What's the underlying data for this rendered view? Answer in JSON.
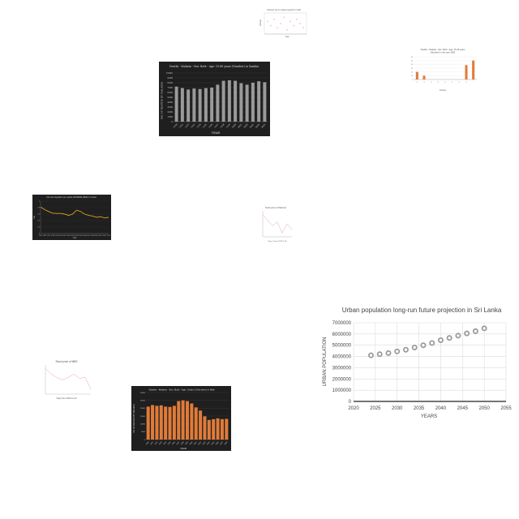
{
  "chart_data": [
    {
      "id": "scatter_top",
      "type": "scatter",
      "title": "Uranium use in nuclear reactors in USA",
      "xlabel": "Year",
      "ylabel": "Tonnes",
      "x": [
        1,
        2,
        3,
        4,
        5,
        6,
        7,
        8,
        9,
        10,
        11,
        12
      ],
      "values": [
        6,
        4,
        7,
        3,
        5,
        8,
        2,
        6,
        4,
        7,
        5,
        3
      ],
      "xlim": [
        0,
        13
      ],
      "ylim": [
        0,
        10
      ],
      "colors": {
        "marker": "#d66a8a"
      }
    },
    {
      "id": "bar_orange_small",
      "type": "bar",
      "title": "Deaths - Malaria - Sex: Both - Age: 15-49 years",
      "subtitle": "(Number) in the year 1990",
      "xlabel": "Country",
      "categories": [
        "A",
        "B",
        "C",
        "D",
        "E",
        "F",
        "G",
        "H",
        "I"
      ],
      "values": [
        20,
        10,
        0,
        0,
        0,
        0,
        0,
        38,
        50
      ],
      "ylim": [
        0,
        60
      ],
      "colors": {
        "bar": "#e07b39"
      }
    },
    {
      "id": "bar_dark_grey",
      "type": "bar",
      "title": "Deaths - Malaria - Sex: Both - Age: 15-49 years (Number) in Zambia",
      "xlabel": "YEAR",
      "ylabel": "NO OF DEATHS BY MALARIA",
      "categories": [
        "1990",
        "1991",
        "1992",
        "1993",
        "1994",
        "1995",
        "1996",
        "1997",
        "1998",
        "1999",
        "2000",
        "2001",
        "2002",
        "2003",
        "2004",
        "2005"
      ],
      "values": [
        7200,
        6900,
        6600,
        6800,
        6700,
        6900,
        7000,
        7600,
        8400,
        8500,
        8400,
        7900,
        7600,
        8000,
        8300,
        8100
      ],
      "ylim": [
        0,
        10000
      ],
      "colors": {
        "bar": "#9a9a9a",
        "background": "#1f1f1f"
      }
    },
    {
      "id": "line_dark_orange",
      "type": "line",
      "title": "Net net migration per capita (NORMALIZED) in Israel",
      "xlabel": "Year",
      "ylabel": "Net",
      "x": [
        1995,
        1996,
        1997,
        1998,
        1999,
        2000,
        2001,
        2002,
        2003,
        2004,
        2005,
        2006,
        2007,
        2008,
        2009,
        2010,
        2011,
        2012
      ],
      "values": [
        0.82,
        0.74,
        0.68,
        0.63,
        0.62,
        0.62,
        0.6,
        0.56,
        0.6,
        0.72,
        0.68,
        0.6,
        0.56,
        0.54,
        0.5,
        0.52,
        0.48,
        0.5
      ],
      "ylim": [
        0,
        1
      ],
      "colors": {
        "line": "#d9a21b",
        "background": "#1f1f1f"
      }
    },
    {
      "id": "line_pink_mid",
      "type": "line",
      "title": "Stock price of Walmart",
      "xlabel": "Days / Years 2019 to 20",
      "x": [
        1,
        2,
        3,
        4,
        5,
        6,
        7
      ],
      "values": [
        60,
        45,
        30,
        40,
        10,
        35,
        20
      ],
      "ylim": [
        0,
        70
      ],
      "colors": {
        "line": "#e8a0b4"
      }
    },
    {
      "id": "scatter_urban",
      "type": "scatter",
      "title": "Urban population long-run future projection in Sri Lanka",
      "xlabel": "YEARS",
      "ylabel": "URBAN POPULATION",
      "x": [
        2024,
        2026,
        2028,
        2030,
        2032,
        2034,
        2036,
        2038,
        2040,
        2042,
        2044,
        2046,
        2048,
        2050
      ],
      "values": [
        4100000,
        4200000,
        4300000,
        4450000,
        4600000,
        4800000,
        5000000,
        5200000,
        5450000,
        5650000,
        5850000,
        6050000,
        6250000,
        6500000
      ],
      "xlim": [
        2020,
        2055
      ],
      "ylim": [
        0,
        7000000
      ],
      "xticks": [
        "2020",
        "2025",
        "2030",
        "2035",
        "2040",
        "2045",
        "2050",
        "2055"
      ],
      "yticks": [
        "0",
        "1000000",
        "2000000",
        "3000000",
        "4000000",
        "5000000",
        "6000000",
        "7000000"
      ],
      "grid": true,
      "colors": {
        "marker": "#9b9b9b"
      }
    },
    {
      "id": "line_pink_small",
      "type": "line",
      "title": "Stock price of MBS",
      "xlabel": "Days from 2019 to 20",
      "x": [
        1,
        2,
        3,
        4,
        5,
        6,
        7,
        8,
        9
      ],
      "values": [
        62,
        48,
        40,
        34,
        40,
        48,
        38,
        40,
        12
      ],
      "ylim": [
        0,
        70
      ],
      "colors": {
        "line": "#e8a0b4"
      }
    },
    {
      "id": "bar_dark_orange",
      "type": "bar",
      "title": "Deaths - Malaria - Sex: Both - Age: Under 5 (Number) in Mali",
      "xlabel": "YEAR",
      "ylabel": "NO OF DEATHS BY MALARIA",
      "categories": [
        "1990",
        "1991",
        "1992",
        "1993",
        "1994",
        "1995",
        "1996",
        "1997",
        "1998",
        "1999",
        "2000",
        "2001",
        "2002",
        "2003",
        "2004",
        "2005",
        "2006",
        "2007",
        "2008"
      ],
      "values": [
        21000,
        22000,
        21500,
        21800,
        21000,
        20800,
        21500,
        24500,
        25000,
        24500,
        23000,
        20500,
        18500,
        14800,
        12500,
        13000,
        13500,
        13000,
        13200
      ],
      "ylim": [
        0,
        30000
      ],
      "colors": {
        "bar": "#e07b39",
        "background": "#1f1f1f"
      }
    }
  ]
}
